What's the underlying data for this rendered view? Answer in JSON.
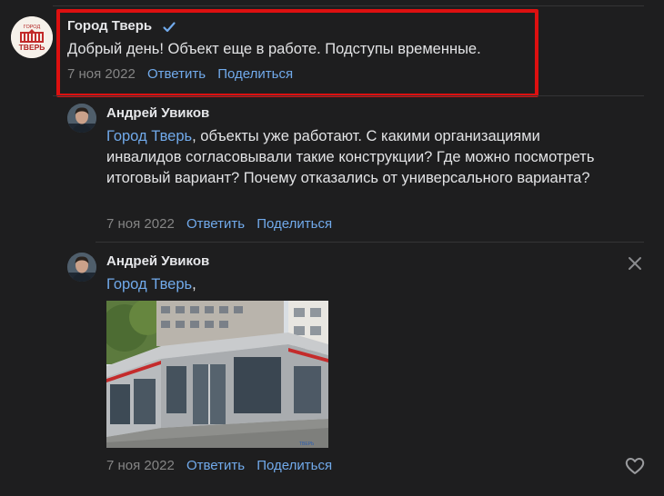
{
  "comment_reply_city": {
    "author": "Город Тверь",
    "verified_icon": "checkmark-icon",
    "avatar_text_top": "ГОРОД",
    "avatar_text_bottom": "ТВЕРЬ",
    "text": "Добрый день! Объект еще в работе. Подступы временные.",
    "date": "7 ноя 2022",
    "reply_label": "Ответить",
    "share_label": "Поделиться"
  },
  "comment_1": {
    "author": "Андрей Увиков",
    "mention": "Город Тверь",
    "text": ", объекты уже работают. С какими организациями инвалидов согласовывали такие конструкции? Где можно посмотреть итоговый вариант? Почему отказались от универсального варианта?",
    "date": "7 ноя 2022",
    "reply_label": "Ответить",
    "share_label": "Поделиться"
  },
  "comment_2": {
    "author": "Андрей Увиков",
    "mention": "Город Тверь",
    "text": ",",
    "photo_caption": "ТВЕРЬ",
    "date": "7 ноя 2022",
    "reply_label": "Ответить",
    "share_label": "Поделиться"
  },
  "icons": {
    "close": "close-icon",
    "like": "heart-icon"
  },
  "colors": {
    "background": "#1e1e1f",
    "link": "#71aaeb",
    "highlight": "#dd1010",
    "muted": "#858585"
  }
}
